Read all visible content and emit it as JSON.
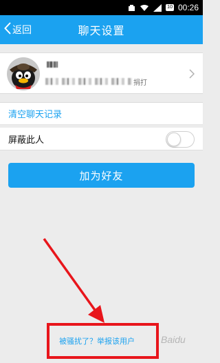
{
  "status_bar": {
    "time": "00:26",
    "battery": "10",
    "icons": [
      "notification-icon",
      "wifi-icon",
      "signal-icon",
      "battery-icon"
    ]
  },
  "title_bar": {
    "back_label": "返回",
    "title": "聊天设置"
  },
  "profile": {
    "signature_suffix": "捐打"
  },
  "menu": {
    "clear_history": "清空聊天记录",
    "block_user": "屏蔽此人",
    "block_enabled": false
  },
  "add_friend_label": "加为好友",
  "report_link": "被骚扰了？举报该用户",
  "watermark_text": "Baidu",
  "colors": {
    "accent": "#1ba2f0",
    "annotation_red": "#e8151b"
  }
}
